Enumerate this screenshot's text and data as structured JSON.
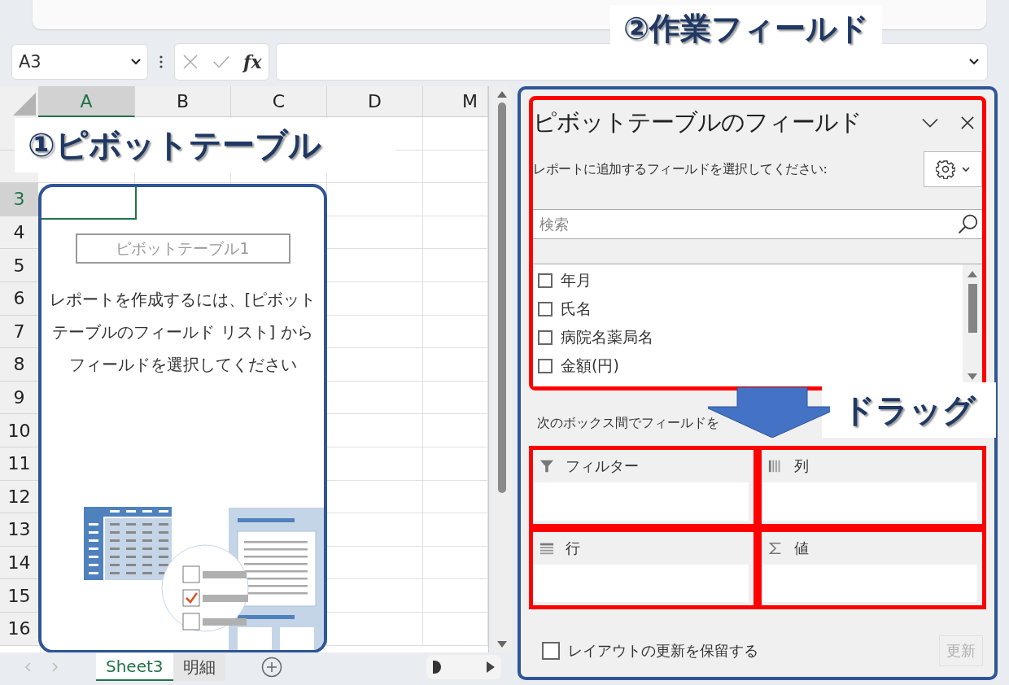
{
  "name_box": {
    "value": "A3"
  },
  "formula_bar": {
    "function_label": "fx"
  },
  "columns": [
    {
      "label": "A",
      "selected": true
    },
    {
      "label": "B",
      "selected": false
    },
    {
      "label": "C",
      "selected": false
    },
    {
      "label": "D",
      "selected": false
    },
    {
      "label": "M",
      "selected": false
    }
  ],
  "rows": [
    {
      "label": "3",
      "selected": true
    },
    {
      "label": "4",
      "selected": false
    },
    {
      "label": "5",
      "selected": false
    },
    {
      "label": "6",
      "selected": false
    },
    {
      "label": "7",
      "selected": false
    },
    {
      "label": "8",
      "selected": false
    },
    {
      "label": "9",
      "selected": false
    },
    {
      "label": "10",
      "selected": false
    },
    {
      "label": "11",
      "selected": false
    },
    {
      "label": "12",
      "selected": false
    },
    {
      "label": "13",
      "selected": false
    },
    {
      "label": "14",
      "selected": false
    },
    {
      "label": "15",
      "selected": false
    },
    {
      "label": "16",
      "selected": false
    }
  ],
  "pivot_placeholder": {
    "name": "ピボットテーブル1",
    "message": "レポートを作成するには、[ピボットテーブルのフィールド リスト] からフィールドを選択してください"
  },
  "sheet_tabs": [
    {
      "label": "Sheet3",
      "selected": true
    },
    {
      "label": "明細",
      "selected": false
    }
  ],
  "field_pane": {
    "title": "ピボットテーブルのフィールド",
    "instruction": "レポートに追加するフィールドを選択してください:",
    "search": {
      "placeholder": "検索"
    },
    "fields": [
      {
        "label": "年月",
        "checked": false
      },
      {
        "label": "氏名",
        "checked": false
      },
      {
        "label": "病院名薬局名",
        "checked": false
      },
      {
        "label": "金額(円)",
        "checked": false
      }
    ],
    "areas_hint": "次のボックス間でフィールドを",
    "areas": [
      {
        "kind": "filter",
        "label": "フィルター"
      },
      {
        "kind": "columns",
        "label": "列"
      },
      {
        "kind": "rows",
        "label": "行"
      },
      {
        "kind": "values",
        "label": "値"
      }
    ],
    "defer": {
      "label": "レイアウトの更新を保留する",
      "checked": false
    },
    "update_button": {
      "label": "更新",
      "disabled": true
    }
  },
  "annotations": [
    {
      "kind": "work",
      "label": "②作業フィールド"
    },
    {
      "kind": "pivot",
      "label": "①ピボットテーブル"
    },
    {
      "kind": "drag",
      "label": "ドラッグ"
    }
  ]
}
